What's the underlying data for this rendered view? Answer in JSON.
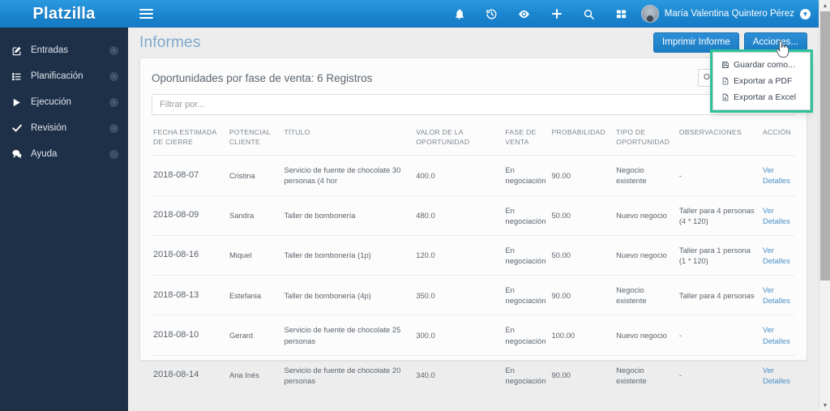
{
  "brand": {
    "name": "Platzilla"
  },
  "topbar": {
    "hamburger_icon": "hamburger-menu-icon",
    "icons": [
      {
        "name": "bell-icon",
        "label": "Notificaciones"
      },
      {
        "name": "history-icon",
        "label": "Historial"
      },
      {
        "name": "eye-icon",
        "label": "Seguimiento"
      },
      {
        "name": "plus-icon",
        "label": "Crear"
      },
      {
        "name": "search-icon",
        "label": "Buscar"
      },
      {
        "name": "grid-icon",
        "label": "Aplicaciones"
      }
    ],
    "username": "María Valentina Quintero Pérez",
    "caret": "▼"
  },
  "sidebar": {
    "items": [
      {
        "label": "Entradas",
        "icon": "edit-square-icon",
        "arrow": "›"
      },
      {
        "label": "Planificación",
        "icon": "list-icon",
        "arrow": "›"
      },
      {
        "label": "Ejecución",
        "icon": "play-icon",
        "arrow": "›"
      },
      {
        "label": "Revisión",
        "icon": "check-icon",
        "arrow": "›"
      },
      {
        "label": "Ayuda",
        "icon": "chat-bubble-icon",
        "arrow": ""
      }
    ]
  },
  "page": {
    "title": "Informes",
    "print_button": "Imprimir Informe",
    "actions_button": "Acciones..."
  },
  "actions_menu": {
    "highlighted": true,
    "highlight_color": "#2ec29a",
    "items": [
      {
        "label": "Guardar como...",
        "icon": "save-floppy-icon"
      },
      {
        "label": "Exportar a PDF",
        "icon": "pdf-file-icon"
      },
      {
        "label": "Exportar a Excel",
        "icon": "excel-file-icon"
      }
    ]
  },
  "card": {
    "title": "Oportunidades por fase de venta: 6 Registros",
    "report_select_value": "Oportunidades por f...",
    "filter_placeholder": "Filtrar por...",
    "filter_value": ""
  },
  "table": {
    "columns": [
      "FECHA ESTIMADA DE CIERRE",
      "POTENCIAL CLIENTE",
      "TÍTULO",
      "VALOR DE LA OPORTUNIDAD",
      "FASE DE VENTA",
      "PROBABILIDAD",
      "TIPO DE OPORTUNIDAD",
      "OBSERVACIONES",
      "ACCIÓN"
    ],
    "action_label": "Ver Detalles",
    "rows": [
      {
        "fecha": "2018-08-07",
        "cliente": "Cristina",
        "titulo": "Servicio de fuente de chocolate 30 personas (4 hor",
        "valor": "400.0",
        "fase": "En negociación",
        "probabilidad": "90.00",
        "tipo": "Negocio existente",
        "observaciones": "-"
      },
      {
        "fecha": "2018-08-09",
        "cliente": "Sandra",
        "titulo": "Taller de bombonería",
        "valor": "480.0",
        "fase": "En negociación",
        "probabilidad": "50.00",
        "tipo": "Nuevo negocio",
        "observaciones": "Taller para 4 personas (4 * 120)"
      },
      {
        "fecha": "2018-08-16",
        "cliente": "Miquel",
        "titulo": "Taller de bombonería (1p)",
        "valor": "120.0",
        "fase": "En negociación",
        "probabilidad": "50.00",
        "tipo": "Nuevo negocio",
        "observaciones": "Taller para 1 persona (1 * 120)"
      },
      {
        "fecha": "2018-08-13",
        "cliente": "Estefania",
        "titulo": "Taller de bombonería (4p)",
        "valor": "350.0",
        "fase": "En negociación",
        "probabilidad": "90.00",
        "tipo": "Negocio existente",
        "observaciones": "Taller para 4 personas"
      },
      {
        "fecha": "2018-08-10",
        "cliente": "Gerard",
        "titulo": "Servicio de fuente de chocolate 25 personas",
        "valor": "300.0",
        "fase": "En negociación",
        "probabilidad": "100.00",
        "tipo": "Nuevo negocio",
        "observaciones": "-"
      },
      {
        "fecha": "2018-08-14",
        "cliente": "Ana Inés",
        "titulo": "Servicio de fuente de chocolate 20 personas",
        "valor": "340.0",
        "fase": "En negociación",
        "probabilidad": "90.00",
        "tipo": "Negocio existente",
        "observaciones": "-"
      }
    ]
  },
  "scrollbar": {
    "up_arrow": "▲",
    "down_arrow": "▼"
  },
  "colors": {
    "header_blue": "#1a85cf",
    "sidebar_navy": "#1e3048",
    "accent_link": "#4a90c9",
    "highlight_green": "#2ec29a",
    "title_blue": "#7fa8cd"
  }
}
